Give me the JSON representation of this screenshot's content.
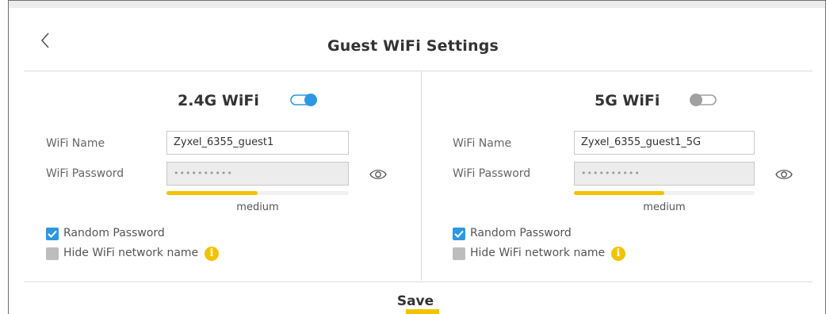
{
  "page": {
    "title": "Guest WiFi Settings"
  },
  "bands": [
    {
      "name": "2.4G WiFi",
      "enabled": true,
      "wifi_name_label": "WiFi Name",
      "wifi_name_value": "Zyxel_6355_guest1",
      "wifi_password_label": "WiFi Password",
      "wifi_password_value": "••••••••••",
      "strength_label": "medium",
      "strength_level": 0.5,
      "random_password_label": "Random Password",
      "random_password_checked": true,
      "hide_name_label": "Hide WiFi network name",
      "hide_name_checked": false
    },
    {
      "name": "5G WiFi",
      "enabled": false,
      "wifi_name_label": "WiFi Name",
      "wifi_name_value": "Zyxel_6355_guest1_5G",
      "wifi_password_label": "WiFi Password",
      "wifi_password_value": "••••••••••",
      "strength_label": "medium",
      "strength_level": 0.5,
      "random_password_label": "Random Password",
      "random_password_checked": true,
      "hide_name_label": "Hide WiFi network name",
      "hide_name_checked": false
    }
  ],
  "actions": {
    "save_label": "Save"
  },
  "icons": {
    "back": "chevron-left-icon",
    "toggle": "toggle-switch-icon",
    "eye": "eye-icon",
    "info": "info-icon",
    "info_glyph": "i"
  },
  "colors": {
    "accent": "#2d98e0",
    "toggle_off": "#a0a0a0",
    "strength": "#f2c200",
    "info": "#f2c200"
  }
}
